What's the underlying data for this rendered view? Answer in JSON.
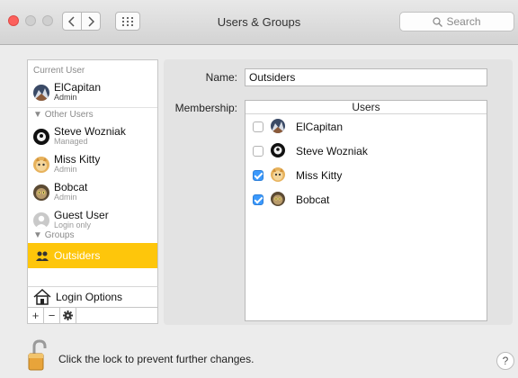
{
  "window": {
    "title": "Users & Groups",
    "search_placeholder": "Search"
  },
  "sidebar": {
    "current_user_label": "Current User",
    "current_user": {
      "name": "ElCapitan",
      "role": "Admin"
    },
    "other_users_label": "Other Users",
    "other_users": [
      {
        "name": "Steve Wozniak",
        "role": "Managed"
      },
      {
        "name": "Miss Kitty",
        "role": "Admin"
      },
      {
        "name": "Bobcat",
        "role": "Admin"
      },
      {
        "name": "Guest User",
        "role": "Login only"
      }
    ],
    "groups_label": "Groups",
    "groups": [
      {
        "name": "Outsiders",
        "selected": true
      }
    ],
    "login_options_label": "Login Options",
    "add_button": "+",
    "remove_button": "−"
  },
  "detail": {
    "name_label": "Name:",
    "name_value": "Outsiders",
    "membership_label": "Membership:",
    "members_header": "Users",
    "members": [
      {
        "name": "ElCapitan",
        "checked": false
      },
      {
        "name": "Steve Wozniak",
        "checked": false
      },
      {
        "name": "Miss Kitty",
        "checked": true
      },
      {
        "name": "Bobcat",
        "checked": true
      }
    ]
  },
  "footer": {
    "lock_text": "Click the lock to prevent further changes.",
    "help_label": "?"
  },
  "colors": {
    "selection": "#fec60b",
    "checkbox_on": "#3b99fc",
    "close_button": "#fc605c"
  }
}
